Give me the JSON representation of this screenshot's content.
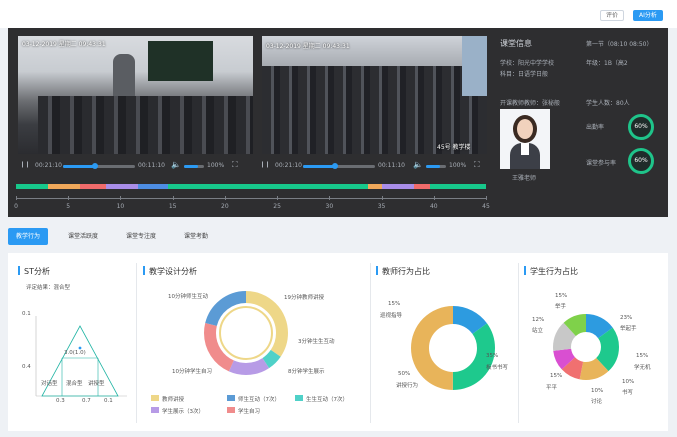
{
  "header": {
    "eval_button": "评价",
    "ai_button": "AI分析"
  },
  "videos": [
    {
      "timestamp": "03-12-2019 星期二 09:43:31",
      "current": "00:21:10",
      "total": "00:11:10",
      "volume": "100%",
      "progress": 0.45
    },
    {
      "timestamp": "03-12-2019 星期二 09:43:31",
      "watermark": "45号 教学楼",
      "current": "00:21:10",
      "total": "00:11:10",
      "volume": "100%",
      "progress": 0.45
    }
  ],
  "class_info": {
    "title": "课堂信息",
    "period": "第一节（08:10 08:50）",
    "school": "学校：阳光中学学校",
    "grade": "年级：1B（高2",
    "subject": "科目：日语学日般",
    "teacher_label": "开课教师教师：张秘般",
    "student_count": "学生人数：80人",
    "teacher_name": "王雅老师",
    "metrics": [
      {
        "label": "出勤率",
        "value": "60%"
      },
      {
        "label": "课堂参与率",
        "value": "60%"
      }
    ]
  },
  "timeline": {
    "ticks": [
      "0",
      "5",
      "10",
      "15",
      "20",
      "25",
      "30",
      "35",
      "40",
      "45"
    ],
    "colors": {
      "green": "#17c88b",
      "orange": "#f0a85a",
      "red": "#f06b6b",
      "purple": "#a98de8",
      "blue": "#4d8de3"
    }
  },
  "tabs": [
    {
      "label": "教学行为",
      "active": true
    },
    {
      "label": "课堂活跃度",
      "active": false
    },
    {
      "label": "课堂专注度",
      "active": false
    },
    {
      "label": "课堂考勤",
      "active": false
    }
  ],
  "st_analysis": {
    "title": "ST分析",
    "result": "评定结果：混合型",
    "y_labels": [
      "0.1",
      "0.4"
    ],
    "x_labels": [
      "0.3",
      "0.7",
      "0.1"
    ],
    "zone_labels": [
      "对话型",
      "混合型",
      "讲授型"
    ],
    "point_label": "3.0(1.0)"
  },
  "teaching_design": {
    "title": "教学设计分析",
    "labels": [
      "10分钟师生互动",
      "19分钟教师讲授",
      "3分钟生生互动",
      "8分钟学生展示",
      "10分钟学生自习"
    ],
    "legend": [
      {
        "label": "教师讲授",
        "color": "#eed788"
      },
      {
        "label": "师生互动（7次）",
        "color": "#5b9bd5"
      },
      {
        "label": "生生互动（7次）",
        "color": "#4fd1c8"
      },
      {
        "label": "学生展示（3次）",
        "color": "#b79be6"
      },
      {
        "label": "学生自习",
        "color": "#f08c8c"
      }
    ]
  },
  "teacher_behavior": {
    "title": "教师行为占比",
    "segments": [
      {
        "label": "巡视指导",
        "pct": "15%",
        "value": 15,
        "color": "#2d9be0"
      },
      {
        "label": "板书书写",
        "pct": "35%",
        "value": 35,
        "color": "#1ec98d"
      },
      {
        "label": "讲授行为",
        "pct": "50%",
        "value": 50,
        "color": "#e8b45a"
      }
    ]
  },
  "student_behavior": {
    "title": "学生行为占比",
    "segments": [
      {
        "label": "举手",
        "pct": "15%",
        "value": 15,
        "color": "#2d9be0"
      },
      {
        "label": "举起手",
        "pct": "23%",
        "value": 23,
        "color": "#1ec98d"
      },
      {
        "label": "学无机",
        "pct": "15%",
        "value": 15,
        "color": "#e8b45a"
      },
      {
        "label": "书写",
        "pct": "10%",
        "value": 10,
        "color": "#f07070"
      },
      {
        "label": "讨论",
        "pct": "10%",
        "value": 10,
        "color": "#d94fd1"
      },
      {
        "label": "平平",
        "pct": "15%",
        "value": 15,
        "color": "#c8c8c8"
      },
      {
        "label": "站立",
        "pct": "12%",
        "value": 12,
        "color": "#7fd14a"
      }
    ]
  }
}
